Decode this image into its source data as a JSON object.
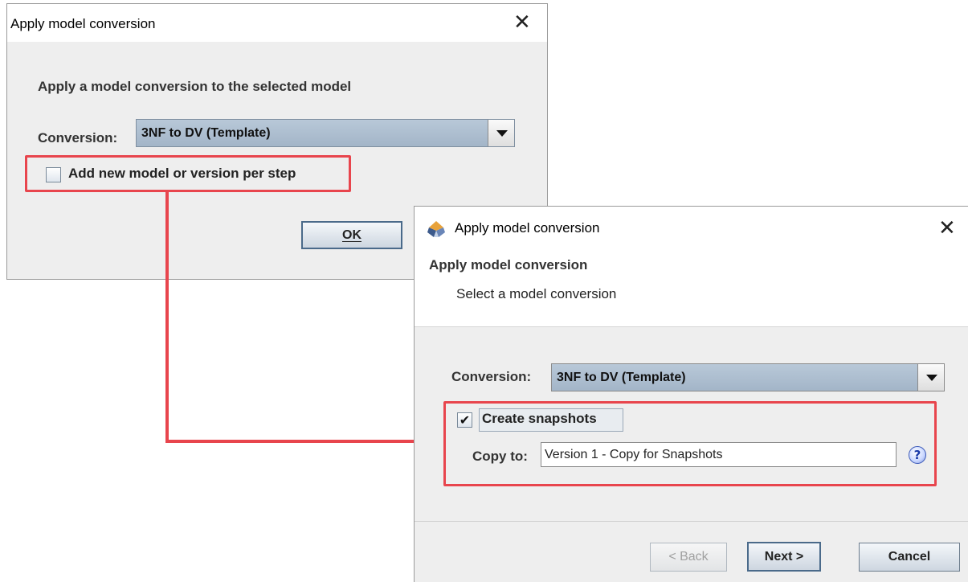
{
  "dialog1": {
    "title": "Apply model conversion",
    "heading": "Apply a model conversion to the selected model",
    "conversion_label": "Conversion:",
    "conversion_value": "3NF to DV (Template)",
    "checkbox_label": "Add new model or version per step",
    "checkbox_checked": false,
    "ok_label": "OK"
  },
  "dialog2": {
    "title": "Apply model conversion",
    "header_title": "Apply model conversion",
    "header_subtitle": "Select a model conversion",
    "conversion_label": "Conversion:",
    "conversion_value": "3NF to DV (Template)",
    "snapshots_label": "Create snapshots",
    "snapshots_checked": true,
    "copy_to_label": "Copy to:",
    "copy_to_value": "Version 1 - Copy for Snapshots",
    "help_glyph": "?",
    "back_label": "< Back",
    "next_label": "Next >",
    "cancel_label": "Cancel"
  },
  "icons": {
    "close": "close-icon",
    "dropdown": "chevron-down-icon",
    "check": "check-icon",
    "help": "help-icon",
    "app": "app-logo-icon"
  },
  "colors": {
    "highlight": "#e8454d",
    "combo_bg": "#a3b5c8",
    "dialog_bg": "#eeeeee"
  }
}
